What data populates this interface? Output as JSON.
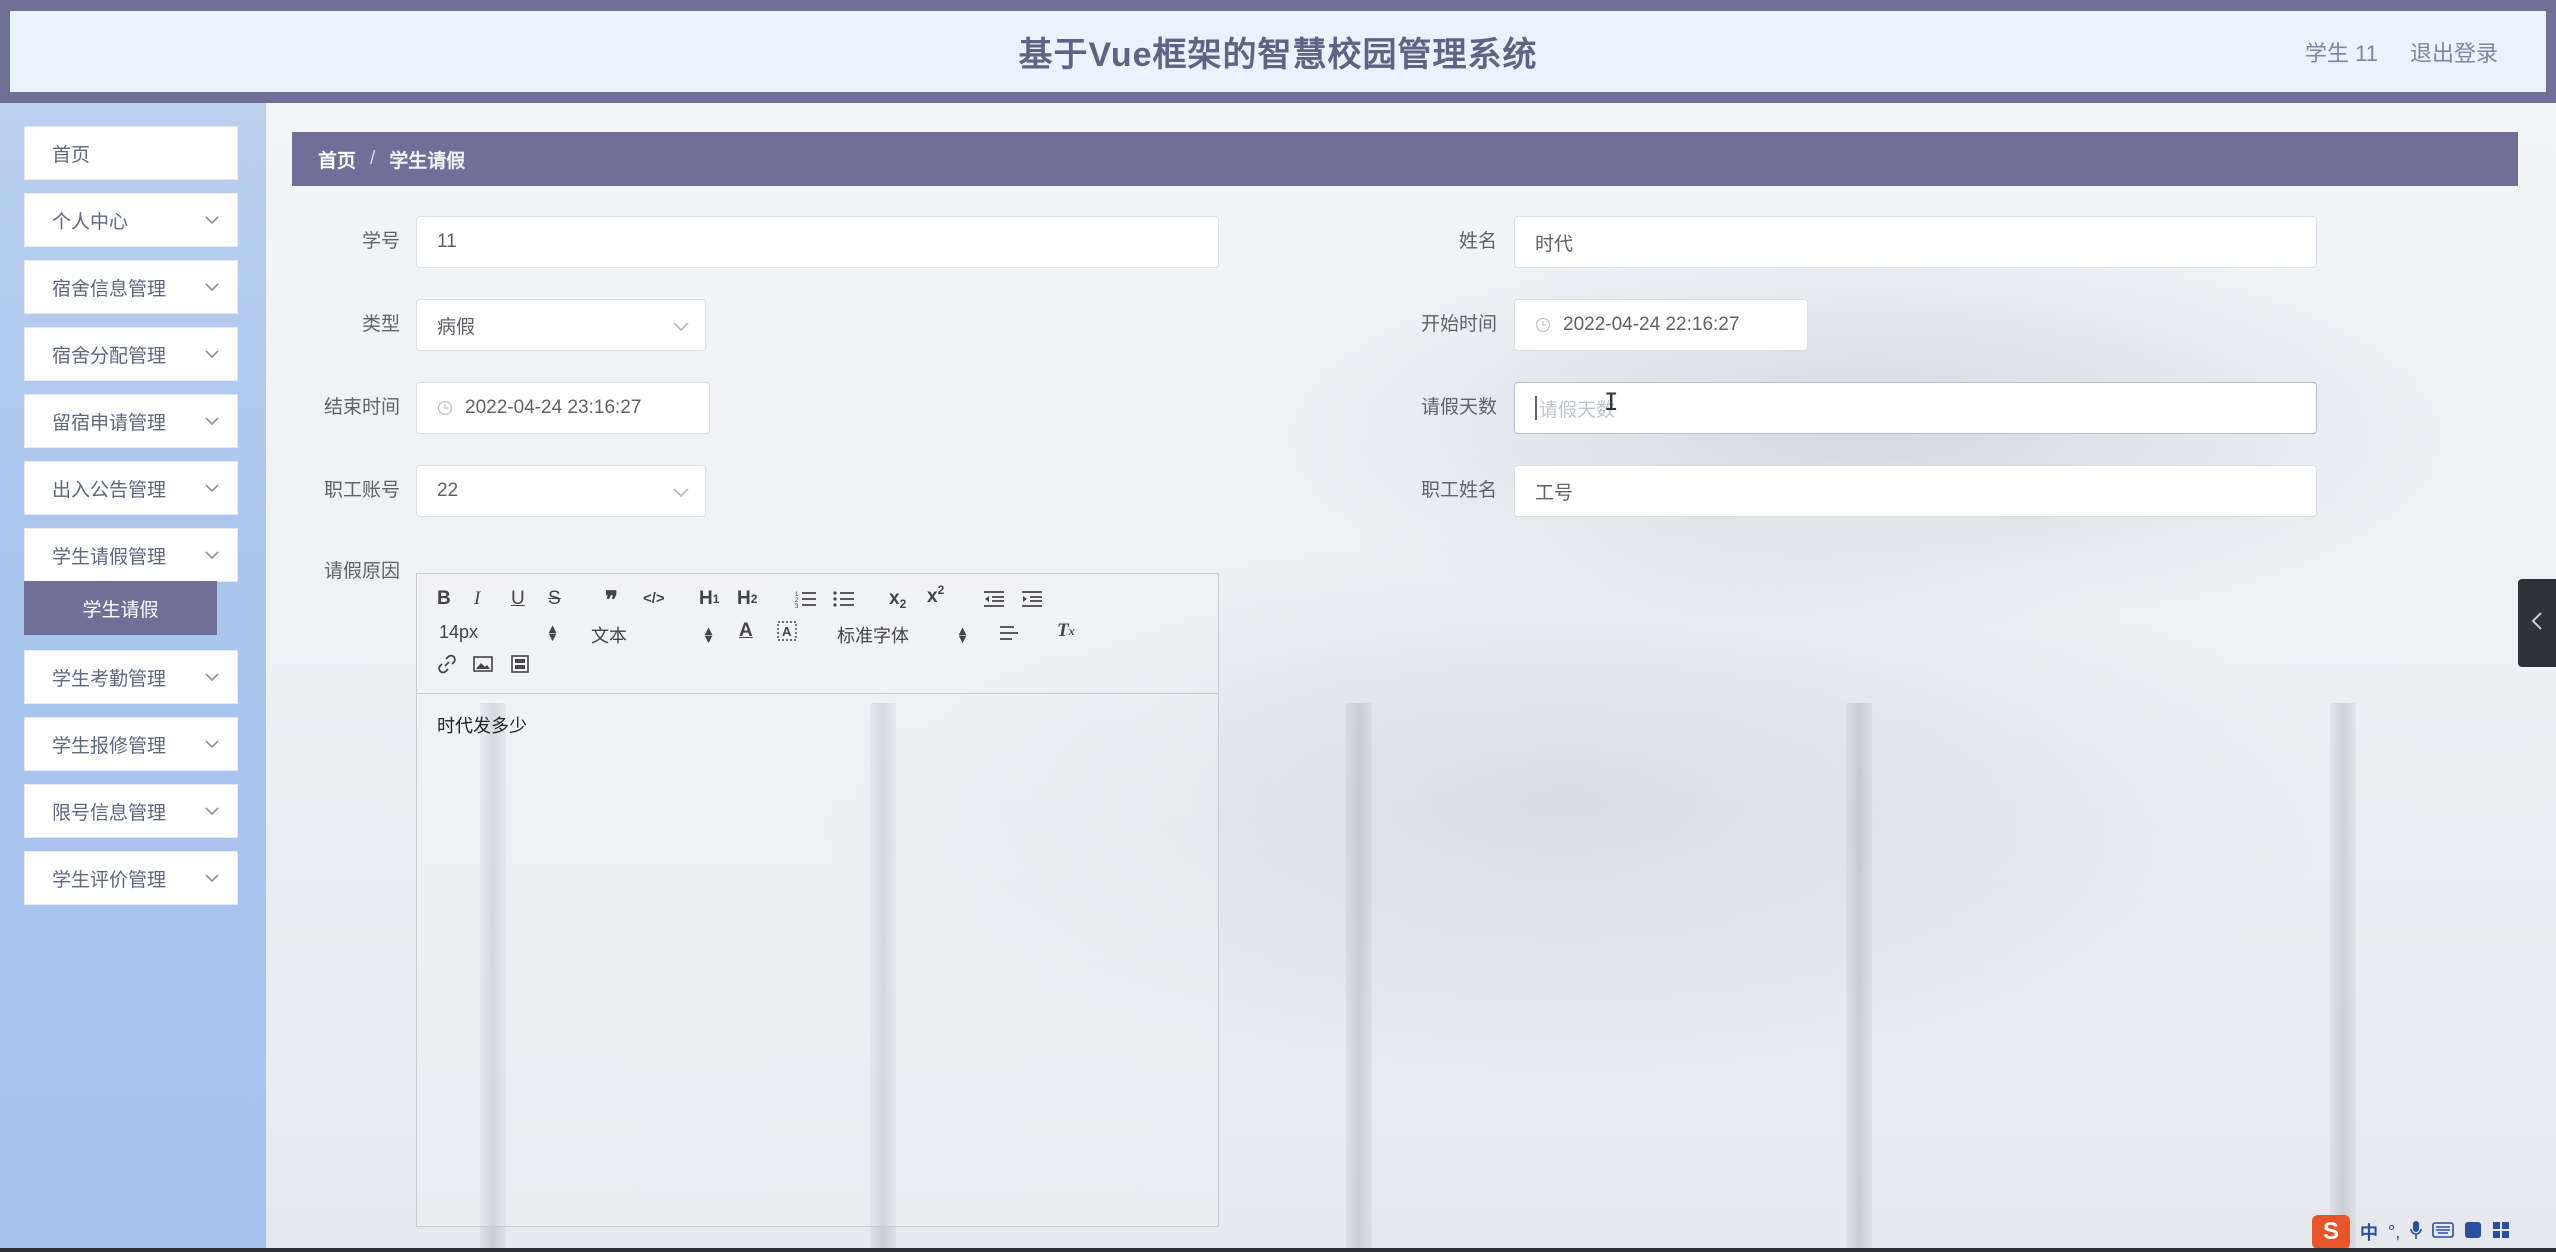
{
  "header": {
    "title": "基于Vue框架的智慧校园管理系统",
    "user_label": "学生 11",
    "logout_label": "退出登录"
  },
  "sidebar": {
    "items": [
      {
        "label": "首页",
        "expandable": false
      },
      {
        "label": "个人中心",
        "expandable": true
      },
      {
        "label": "宿舍信息管理",
        "expandable": true
      },
      {
        "label": "宿舍分配管理",
        "expandable": true
      },
      {
        "label": "留宿申请管理",
        "expandable": true
      },
      {
        "label": "出入公告管理",
        "expandable": true
      },
      {
        "label": "学生请假管理",
        "expandable": true
      },
      {
        "label": "学生考勤管理",
        "expandable": true
      },
      {
        "label": "学生报修管理",
        "expandable": true
      },
      {
        "label": "限号信息管理",
        "expandable": true
      },
      {
        "label": "学生评价管理",
        "expandable": true
      }
    ],
    "active_sub": "学生请假"
  },
  "breadcrumb": {
    "home": "首页",
    "separator": "/",
    "current": "学生请假"
  },
  "form": {
    "student_id": {
      "label": "学号",
      "value": "11"
    },
    "name": {
      "label": "姓名",
      "value": "时代"
    },
    "type": {
      "label": "类型",
      "value": "病假"
    },
    "start_time": {
      "label": "开始时间",
      "value": "2022-04-24 22:16:27"
    },
    "end_time": {
      "label": "结束时间",
      "value": "2022-04-24 23:16:27"
    },
    "leave_days": {
      "label": "请假天数",
      "placeholder": "请假天数",
      "value": ""
    },
    "staff_account": {
      "label": "职工账号",
      "value": "22"
    },
    "staff_name": {
      "label": "职工姓名",
      "value": "工号"
    },
    "reason": {
      "label": "请假原因",
      "content": "时代发多少"
    }
  },
  "editor": {
    "font_size": "14px",
    "heading": "文本",
    "font_family": "标准字体"
  },
  "ime": {
    "logo": "S",
    "mode": "中"
  },
  "colors": {
    "accent": "#6f6f98",
    "header_bg": "#e8f4fd",
    "sidebar_bg": "#a9c5ee"
  }
}
